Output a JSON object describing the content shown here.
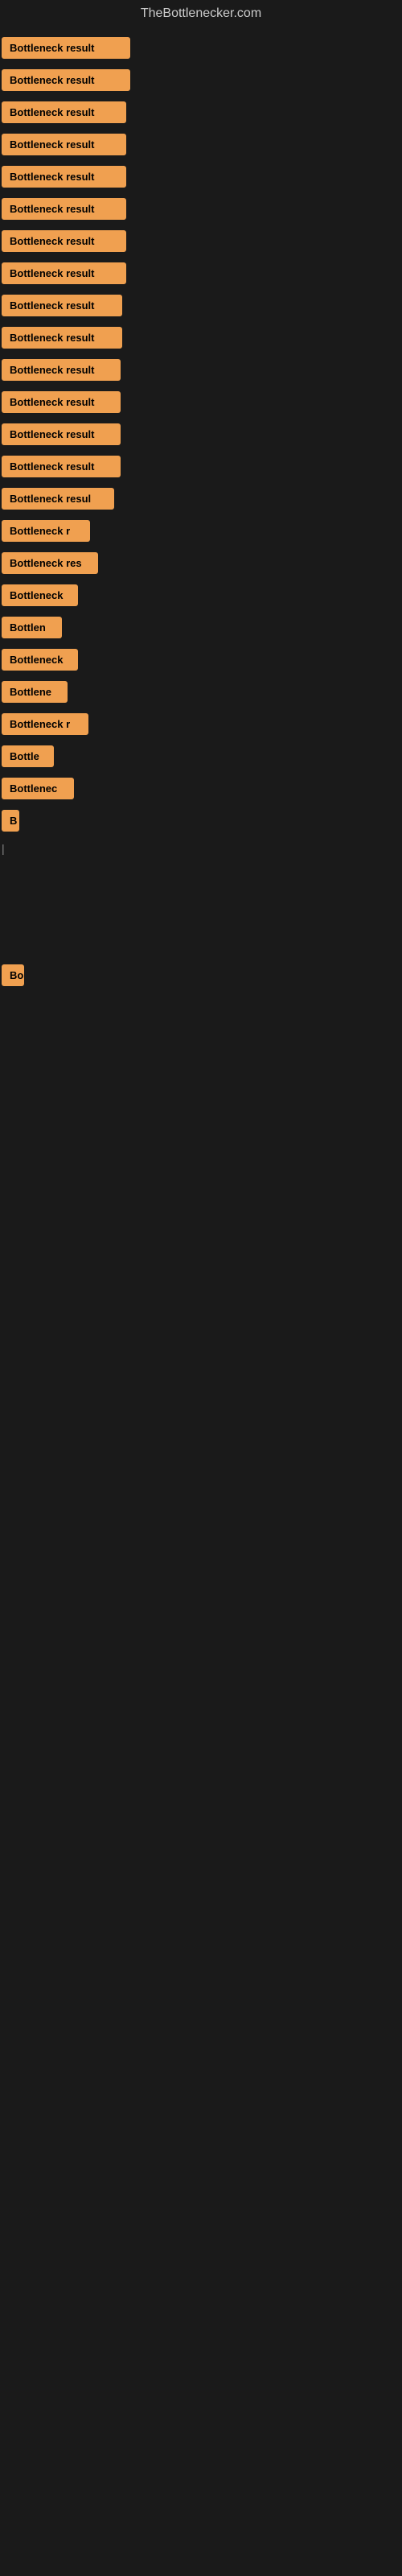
{
  "site": {
    "title": "TheBottlenecker.com"
  },
  "items": [
    {
      "label": "Bottleneck result",
      "width": 160
    },
    {
      "label": "Bottleneck result",
      "width": 160
    },
    {
      "label": "Bottleneck result",
      "width": 155
    },
    {
      "label": "Bottleneck result",
      "width": 155
    },
    {
      "label": "Bottleneck result",
      "width": 155
    },
    {
      "label": "Bottleneck result",
      "width": 155
    },
    {
      "label": "Bottleneck result",
      "width": 155
    },
    {
      "label": "Bottleneck result",
      "width": 155
    },
    {
      "label": "Bottleneck result",
      "width": 150
    },
    {
      "label": "Bottleneck result",
      "width": 150
    },
    {
      "label": "Bottleneck result",
      "width": 148
    },
    {
      "label": "Bottleneck result",
      "width": 148
    },
    {
      "label": "Bottleneck result",
      "width": 148
    },
    {
      "label": "Bottleneck result",
      "width": 148
    },
    {
      "label": "Bottleneck resul",
      "width": 140
    },
    {
      "label": "Bottleneck r",
      "width": 110
    },
    {
      "label": "Bottleneck res",
      "width": 120
    },
    {
      "label": "Bottleneck",
      "width": 95
    },
    {
      "label": "Bottlen",
      "width": 75
    },
    {
      "label": "Bottleneck",
      "width": 95
    },
    {
      "label": "Bottlene",
      "width": 82
    },
    {
      "label": "Bottleneck r",
      "width": 108
    },
    {
      "label": "Bottle",
      "width": 65
    },
    {
      "label": "Bottlenec",
      "width": 90
    },
    {
      "label": "B",
      "width": 22
    },
    {
      "label": "|",
      "width": 10
    },
    {
      "label": "",
      "width": 0
    },
    {
      "label": "",
      "width": 0
    },
    {
      "label": "",
      "width": 0
    },
    {
      "label": "Bo",
      "width": 28
    },
    {
      "label": "",
      "width": 0
    },
    {
      "label": "",
      "width": 0
    },
    {
      "label": "",
      "width": 0
    },
    {
      "label": "",
      "width": 0
    }
  ]
}
